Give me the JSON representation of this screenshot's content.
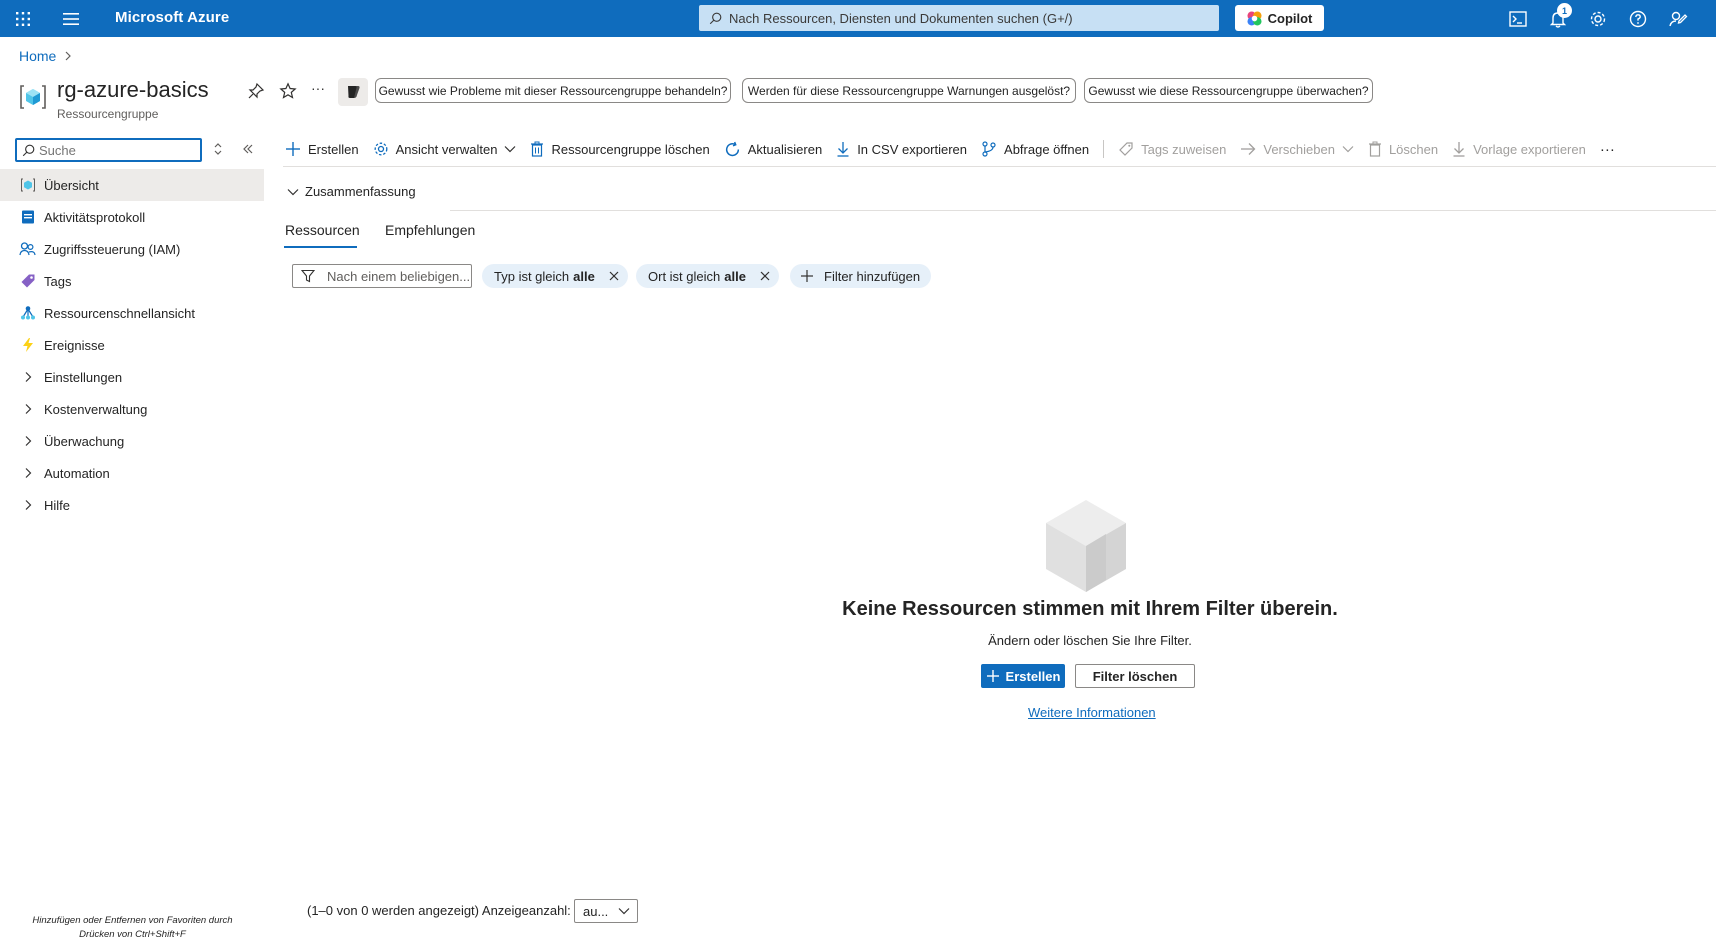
{
  "topbar": {
    "brand": "Microsoft Azure",
    "search_placeholder": "Nach Ressourcen, Diensten und Dokumenten suchen (G+/)",
    "copilot_label": "Copilot",
    "notification_count": "1",
    "bg_color": "#0f6cbd"
  },
  "breadcrumb": {
    "home": "Home"
  },
  "resource": {
    "title": "rg-azure-basics",
    "subtitle": "Ressourcengruppe",
    "more": "···"
  },
  "suggestions": [
    "Gewusst wie Probleme mit dieser Ressourcengruppe behandeln?",
    "Werden für diese Ressourcengruppe Warnungen ausgelöst?",
    "Gewusst wie diese Ressourcengruppe überwachen?"
  ],
  "sidebar": {
    "search_placeholder": "Suche",
    "items": [
      {
        "label": "Übersicht",
        "icon": "resource-group-icon",
        "active": true
      },
      {
        "label": "Aktivitätsprotokoll",
        "icon": "activity-log-icon"
      },
      {
        "label": "Zugriffssteuerung (IAM)",
        "icon": "people-icon"
      },
      {
        "label": "Tags",
        "icon": "tag-icon"
      },
      {
        "label": "Ressourcenschnellansicht",
        "icon": "visualizer-icon"
      },
      {
        "label": "Ereignisse",
        "icon": "lightning-icon"
      },
      {
        "label": "Einstellungen",
        "icon": "chevron-right-icon"
      },
      {
        "label": "Kostenverwaltung",
        "icon": "chevron-right-icon"
      },
      {
        "label": "Überwachung",
        "icon": "chevron-right-icon"
      },
      {
        "label": "Automation",
        "icon": "chevron-right-icon"
      },
      {
        "label": "Hilfe",
        "icon": "chevron-right-icon"
      }
    ],
    "footer_line1": "Hinzufügen oder Entfernen von Favoriten durch",
    "footer_line2": "Drücken von Ctrl+Shift+F"
  },
  "toolbar": {
    "create": "Erstellen",
    "manage_view": "Ansicht verwalten",
    "delete_group": "Ressourcengruppe löschen",
    "refresh": "Aktualisieren",
    "export_csv": "In CSV exportieren",
    "open_query": "Abfrage öffnen",
    "assign_tags": "Tags zuweisen",
    "move": "Verschieben",
    "delete": "Löschen",
    "export_template": "Vorlage exportieren",
    "more": "···"
  },
  "summary_label": "Zusammenfassung",
  "tabs": {
    "resources": "Ressourcen",
    "recommendations": "Empfehlungen"
  },
  "filters": {
    "search_placeholder": "Nach einem beliebigen...",
    "type_prefix": "Typ ist gleich",
    "type_value": "alle",
    "location_prefix": "Ort ist gleich",
    "location_value": "alle",
    "add_filter": "Filter hinzufügen"
  },
  "empty_state": {
    "title": "Keine Ressourcen stimmen mit Ihrem Filter überein.",
    "subtitle": "Ändern oder löschen Sie Ihre Filter.",
    "create_button": "Erstellen",
    "clear_button": "Filter löschen",
    "learn_more": "Weitere Informationen"
  },
  "pagination": {
    "info": "(1–0 von 0 werden angezeigt) Anzeigeanzahl:",
    "count_value": "au..."
  }
}
